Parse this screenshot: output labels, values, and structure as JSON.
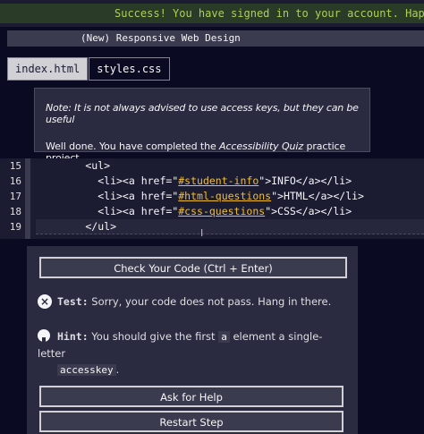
{
  "banner": {
    "text": "Success! You have signed in to your account. Happy"
  },
  "breadcrumb": {
    "text": "(New) Responsive Web Design"
  },
  "tabs": [
    {
      "label": "index.html"
    },
    {
      "label": "styles.css"
    }
  ],
  "notes": {
    "note": "Note: It is not always advised to use access keys, but they can be useful",
    "done_prefix": "Well done. You have completed the ",
    "done_emph": "Accessibility Quiz",
    "done_suffix": " practice project."
  },
  "editor": {
    "line_numbers": [
      "15",
      "16",
      "17",
      "18",
      "19"
    ],
    "lines": [
      {
        "pre": "        <ul>"
      },
      {
        "pre": "          <li><a href=\"",
        "href": "#student-info",
        "post": "\">INFO</a></li>"
      },
      {
        "pre": "          <li><a href=\"",
        "href": "#html-questions",
        "post": "\">HTML</a></li>"
      },
      {
        "pre": "          <li><a href=\"",
        "href": "#css-questions",
        "post": "\">CSS</a></li>"
      },
      {
        "pre": "        </ul>"
      }
    ]
  },
  "actions": {
    "check_label": "Check Your Code (Ctrl + Enter)",
    "help_label": "Ask for Help",
    "restart_label": "Restart Step"
  },
  "test": {
    "label": "Test:",
    "message": "Sorry, your code does not pass. Hang in there."
  },
  "hint": {
    "label": "Hint:",
    "text_before": "You should give the first",
    "code_a": "a",
    "text_after": "element a single-letter",
    "code_key": "accesskey",
    "end": "."
  }
}
